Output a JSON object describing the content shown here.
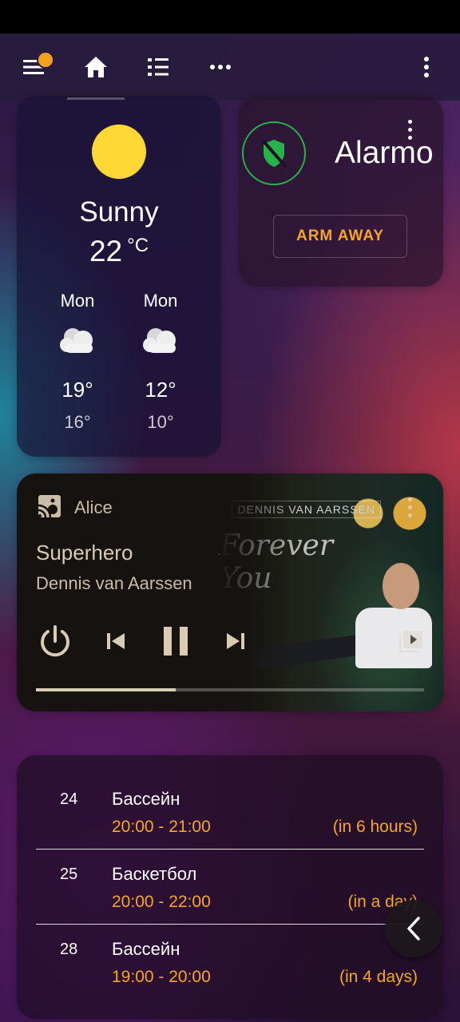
{
  "toolbar": {
    "tabs": [
      {
        "icon": "home-icon",
        "selected": true
      },
      {
        "icon": "list-icon",
        "selected": false
      },
      {
        "icon": "more-horizontal-icon",
        "selected": false
      }
    ],
    "menu_icon": "menu-icon",
    "notification_color": "#f5a020",
    "overflow_icon": "more-vertical-icon"
  },
  "weather": {
    "state": "Sunny",
    "temperature": "22",
    "unit": "°C",
    "forecast": [
      {
        "day": "Mon",
        "icon": "cloudy-icon",
        "high": "19°",
        "low": "16°"
      },
      {
        "day": "Mon",
        "icon": "cloudy-icon",
        "high": "12°",
        "low": "10°"
      }
    ]
  },
  "alarmo": {
    "name": "Alarmo",
    "button_label": "ARM AWAY",
    "status_icon": "shield-off-icon",
    "accent_color": "#26b347",
    "button_color": "#f5a623"
  },
  "media": {
    "player_name": "Alice",
    "title": "Superhero",
    "artist": "Dennis van Aarssen",
    "album_logo": "DENNIS VAN AARSSEN",
    "album_script": "Forever You",
    "progress_percent": 36,
    "text_color": "#d8ccb4"
  },
  "calendar": {
    "events": [
      {
        "day": "24",
        "name": "Бассейн",
        "time": "20:00 - 21:00",
        "relative": "(in 6 hours)"
      },
      {
        "day": "25",
        "name": "Баскетбол",
        "time": "20:00 - 22:00",
        "relative": "(in a day)"
      },
      {
        "day": "28",
        "name": "Бассейн",
        "time": "19:00 - 20:00",
        "relative": "(in 4 days)"
      }
    ],
    "accent_color": "#f5a623"
  }
}
